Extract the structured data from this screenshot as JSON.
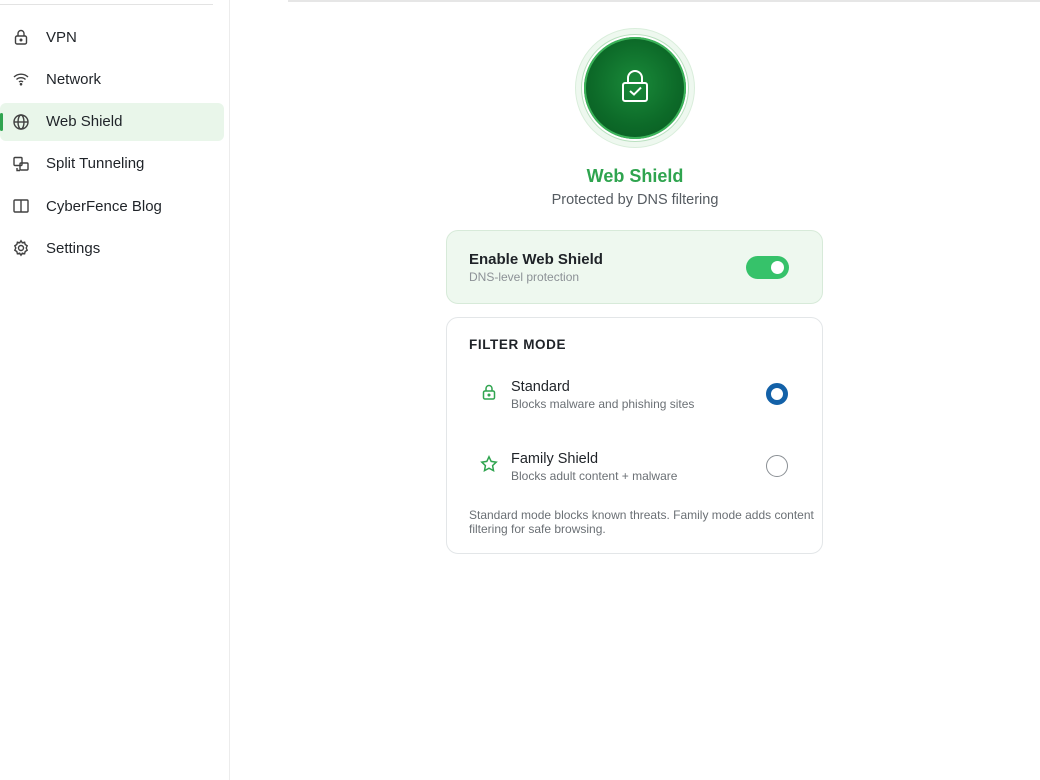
{
  "sidebar": {
    "items": [
      {
        "label": "VPN",
        "icon": "lock-icon",
        "active": false
      },
      {
        "label": "Network",
        "icon": "wifi-icon",
        "active": false
      },
      {
        "label": "Web Shield",
        "icon": "globe-icon",
        "active": true
      },
      {
        "label": "Split Tunneling",
        "icon": "split-icon",
        "active": false
      },
      {
        "label": "CyberFence Blog",
        "icon": "book-icon",
        "active": false
      },
      {
        "label": "Settings",
        "icon": "gear-icon",
        "active": false
      }
    ]
  },
  "hero": {
    "icon": "lock-check-icon",
    "title": "Web Shield",
    "subtitle": "Protected by DNS filtering"
  },
  "enable": {
    "title": "Enable Web Shield",
    "subtitle": "DNS-level protection",
    "enabled": true
  },
  "filter": {
    "heading": "FILTER MODE",
    "options": [
      {
        "title": "Standard",
        "subtitle": "Blocks malware and phishing sites",
        "icon": "lock-icon",
        "selected": true
      },
      {
        "title": "Family Shield",
        "subtitle": "Blocks adult content + malware",
        "icon": "star-icon",
        "selected": false
      }
    ],
    "note": "Standard mode blocks known threats. Family mode adds content filtering for safe browsing."
  },
  "colors": {
    "accent": "#2fa44f",
    "toggle_on": "#36c26a",
    "radio_selected": "#1361a8",
    "active_nav_bg": "#e9f6ea"
  }
}
